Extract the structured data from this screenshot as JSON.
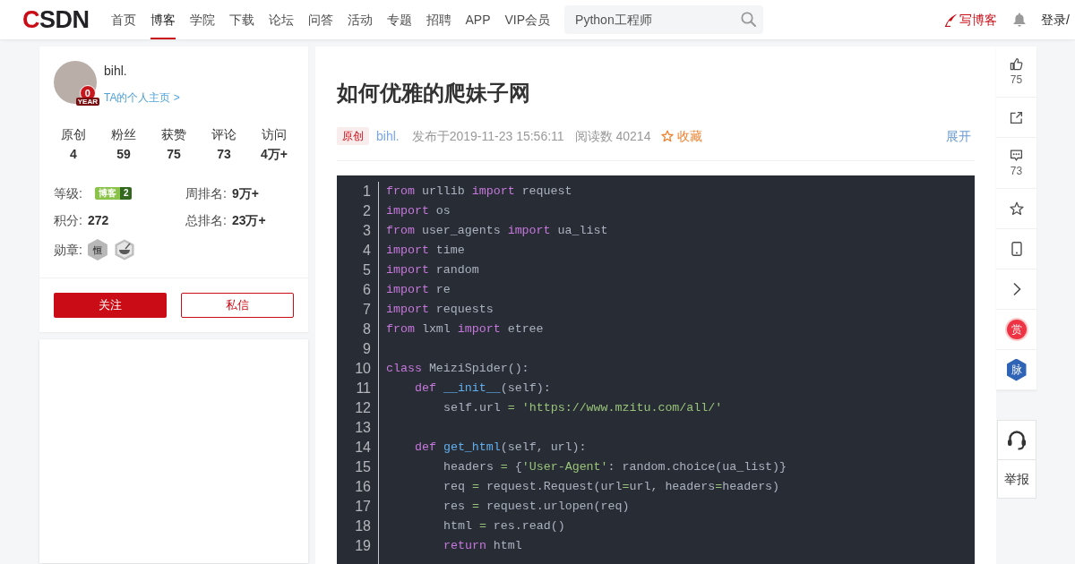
{
  "header": {
    "logo": {
      "accent": "C",
      "rest": "SDN"
    },
    "nav": [
      {
        "label": "首页",
        "selected": false
      },
      {
        "label": "博客",
        "selected": true
      },
      {
        "label": "学院",
        "selected": false
      },
      {
        "label": "下载",
        "selected": false
      },
      {
        "label": "论坛",
        "selected": false
      },
      {
        "label": "问答",
        "selected": false
      },
      {
        "label": "活动",
        "selected": false
      },
      {
        "label": "专题",
        "selected": false
      },
      {
        "label": "招聘",
        "selected": false
      },
      {
        "label": "APP",
        "selected": false
      },
      {
        "label": "VIP会员",
        "selected": false
      }
    ],
    "search": {
      "placeholder": "Python工程师"
    },
    "write_blog": "写博客",
    "login": "登录/"
  },
  "profile": {
    "name": "bihl.",
    "year_badge": {
      "number": "0",
      "label": "YEAR"
    },
    "homepage_link": "TA的个人主页 >",
    "stats": [
      {
        "label": "原创",
        "value": "4"
      },
      {
        "label": "粉丝",
        "value": "59"
      },
      {
        "label": "获赞",
        "value": "75"
      },
      {
        "label": "评论",
        "value": "73"
      },
      {
        "label": "访问",
        "value": "4万+"
      }
    ],
    "info": [
      {
        "kind": "badge",
        "label": "等级:",
        "badge": {
          "text": "博客",
          "number": "2"
        }
      },
      {
        "kind": "text",
        "label": "周排名:",
        "value": "9万+"
      },
      {
        "kind": "text",
        "label": "积分:",
        "value": "272"
      },
      {
        "kind": "text",
        "label": "总排名:",
        "value": "23万+"
      }
    ],
    "medals": {
      "label": "勋章:",
      "items": [
        {
          "kind": "character",
          "text": "恒"
        },
        {
          "kind": "bowl"
        }
      ]
    },
    "buttons": [
      {
        "kind": "primary",
        "label": "关注"
      },
      {
        "kind": "outline",
        "label": "私信"
      }
    ]
  },
  "article": {
    "title": "如何优雅的爬妹子网",
    "meta": {
      "tag": "原创",
      "author": "bihl.",
      "published": "发布于2019-11-23 15:56:11",
      "views": "阅读数 40214",
      "favorite": "收藏",
      "expand": "展开"
    },
    "code": {
      "lines": [
        {
          "number": "1",
          "tokens": [
            {
              "kind": "keyword",
              "text": "from"
            },
            {
              "kind": "plain",
              "text": " urllib "
            },
            {
              "kind": "keyword",
              "text": "import"
            },
            {
              "kind": "plain",
              "text": " request"
            }
          ]
        },
        {
          "number": "2",
          "tokens": [
            {
              "kind": "keyword",
              "text": "import"
            },
            {
              "kind": "plain",
              "text": " os"
            }
          ]
        },
        {
          "number": "3",
          "tokens": [
            {
              "kind": "keyword",
              "text": "from"
            },
            {
              "kind": "plain",
              "text": " user_agents "
            },
            {
              "kind": "keyword",
              "text": "import"
            },
            {
              "kind": "plain",
              "text": " ua_list"
            }
          ]
        },
        {
          "number": "4",
          "tokens": [
            {
              "kind": "keyword",
              "text": "import"
            },
            {
              "kind": "plain",
              "text": " time"
            }
          ]
        },
        {
          "number": "5",
          "tokens": [
            {
              "kind": "keyword",
              "text": "import"
            },
            {
              "kind": "plain",
              "text": " random"
            }
          ]
        },
        {
          "number": "6",
          "tokens": [
            {
              "kind": "keyword",
              "text": "import"
            },
            {
              "kind": "plain",
              "text": " re"
            }
          ]
        },
        {
          "number": "7",
          "tokens": [
            {
              "kind": "keyword",
              "text": "import"
            },
            {
              "kind": "plain",
              "text": " requests"
            }
          ]
        },
        {
          "number": "8",
          "tokens": [
            {
              "kind": "keyword",
              "text": "from"
            },
            {
              "kind": "plain",
              "text": " lxml "
            },
            {
              "kind": "keyword",
              "text": "import"
            },
            {
              "kind": "plain",
              "text": " etree"
            }
          ]
        },
        {
          "number": "9"
        },
        {
          "number": "10",
          "tokens": [
            {
              "kind": "keyword",
              "text": "class"
            },
            {
              "kind": "plain",
              "text": " MeiziSpider():"
            }
          ],
          "children": [
            {
              "number": "11",
              "tokens": [
                {
                  "kind": "keyword",
                  "text": "def"
                },
                {
                  "kind": "function",
                  "text": " __init__"
                },
                {
                  "kind": "plain",
                  "text": "(self):"
                }
              ],
              "children": [
                {
                  "number": "12",
                  "tokens": [
                    {
                      "kind": "plain",
                      "text": "self.url "
                    },
                    {
                      "kind": "operator",
                      "text": "="
                    },
                    {
                      "kind": "string",
                      "text": " 'https://www.mzitu.com/all/'"
                    }
                  ]
                }
              ]
            },
            {
              "number": "13"
            },
            {
              "number": "14",
              "tokens": [
                {
                  "kind": "keyword",
                  "text": "def"
                },
                {
                  "kind": "function",
                  "text": " get_html"
                },
                {
                  "kind": "plain",
                  "text": "(self, url):"
                }
              ],
              "children": [
                {
                  "number": "15",
                  "tokens": [
                    {
                      "kind": "plain",
                      "text": "headers "
                    },
                    {
                      "kind": "operator",
                      "text": "="
                    },
                    {
                      "kind": "plain",
                      "text": " {"
                    },
                    {
                      "kind": "string",
                      "text": "'User-Agent'"
                    },
                    {
                      "kind": "plain",
                      "text": ": random.choice(ua_list)}"
                    }
                  ]
                },
                {
                  "number": "16",
                  "tokens": [
                    {
                      "kind": "plain",
                      "text": "req "
                    },
                    {
                      "kind": "operator",
                      "text": "="
                    },
                    {
                      "kind": "plain",
                      "text": " request.Request(url"
                    },
                    {
                      "kind": "operator",
                      "text": "="
                    },
                    {
                      "kind": "plain",
                      "text": "url, headers"
                    },
                    {
                      "kind": "operator",
                      "text": "="
                    },
                    {
                      "kind": "plain",
                      "text": "headers)"
                    }
                  ]
                },
                {
                  "number": "17",
                  "tokens": [
                    {
                      "kind": "plain",
                      "text": "res "
                    },
                    {
                      "kind": "operator",
                      "text": "="
                    },
                    {
                      "kind": "plain",
                      "text": " request.urlopen(req)"
                    }
                  ]
                },
                {
                  "number": "18",
                  "tokens": [
                    {
                      "kind": "plain",
                      "text": "html "
                    },
                    {
                      "kind": "operator",
                      "text": "="
                    },
                    {
                      "kind": "plain",
                      "text": " res.read()"
                    }
                  ]
                },
                {
                  "number": "19",
                  "tokens": [
                    {
                      "kind": "keyword",
                      "text": "return"
                    },
                    {
                      "kind": "plain",
                      "text": " html"
                    }
                  ]
                }
              ]
            }
          ]
        }
      ]
    }
  },
  "toolbar": {
    "items": [
      {
        "kind": "like",
        "count": "75"
      },
      {
        "kind": "share"
      },
      {
        "kind": "comment",
        "count": "73"
      },
      {
        "kind": "favorite"
      },
      {
        "kind": "mobile"
      },
      {
        "kind": "next"
      },
      {
        "kind": "reward",
        "label": "赏"
      },
      {
        "kind": "network",
        "label": "脉"
      }
    ]
  },
  "help": {
    "items": [
      {
        "kind": "support"
      },
      {
        "kind": "report",
        "label": "举报"
      }
    ]
  }
}
